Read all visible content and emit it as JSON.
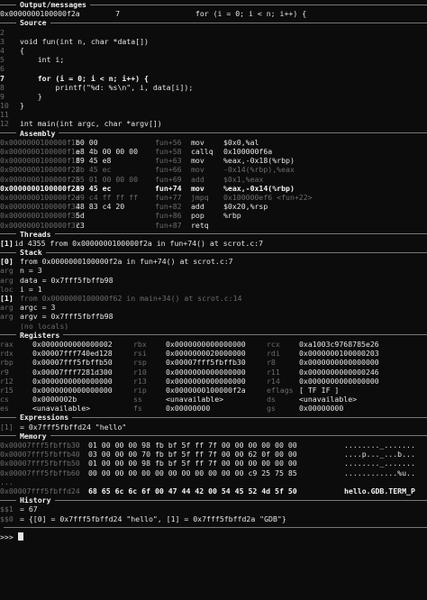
{
  "output": {
    "title": "Output/messages",
    "line": "0x0000000100000f2a        7                 for (i = 0; i < n; i++) {"
  },
  "source": {
    "title": "Source",
    "lines": [
      {
        "num": "2",
        "text": "",
        "cur": false
      },
      {
        "num": "3",
        "text": "void fun(int n, char *data[])",
        "cur": false
      },
      {
        "num": "4",
        "text": "{",
        "cur": false
      },
      {
        "num": "5",
        "text": "    int i;",
        "cur": false
      },
      {
        "num": "6",
        "text": "",
        "cur": false
      },
      {
        "num": "7",
        "text": "    for (i = 0; i < n; i++) {",
        "cur": true
      },
      {
        "num": "8",
        "text": "        printf(\"%d: %s\\n\", i, data[i]);",
        "cur": false
      },
      {
        "num": "9",
        "text": "    }",
        "cur": false
      },
      {
        "num": "10",
        "text": "}",
        "cur": false
      },
      {
        "num": "11",
        "text": "",
        "cur": false
      },
      {
        "num": "12",
        "text": "int main(int argc, char *argv[])",
        "cur": false
      }
    ]
  },
  "assembly": {
    "title": "Assembly",
    "lines": [
      {
        "addr": "0x0000000100000f18",
        "bytes": "b0 00",
        "sym": "fun+56",
        "mnem": "mov",
        "ops": "$0x0,%al",
        "dim": false
      },
      {
        "addr": "0x0000000100000f1a",
        "bytes": "e8 4b 00 00 00",
        "sym": "fun+58",
        "mnem": "callq",
        "ops": "0x100000f6a",
        "dim": false
      },
      {
        "addr": "0x0000000100000f1f",
        "bytes": "89 45 e8",
        "sym": "fun+63",
        "mnem": "mov",
        "ops": "%eax,-0x18(%rbp)",
        "dim": false
      },
      {
        "addr": "0x0000000100000f22",
        "bytes": "8b 45 ec",
        "sym": "fun+66",
        "mnem": "mov",
        "ops": "-0x14(%rbp),%eax",
        "dim": true
      },
      {
        "addr": "0x0000000100000f25",
        "bytes": "05 01 00 00 00",
        "sym": "fun+69",
        "mnem": "add",
        "ops": "$0x1,%eax",
        "dim": true
      },
      {
        "addr": "0x0000000100000f2a",
        "bytes": "89 45 ec",
        "sym": "fun+74",
        "mnem": "mov",
        "ops": "%eax,-0x14(%rbp)",
        "dim": false,
        "cur": true
      },
      {
        "addr": "0x0000000100000f2d",
        "bytes": "e9 c4 ff ff ff",
        "sym": "fun+77",
        "mnem": "jmpq",
        "ops": "0x100000ef6 <fun+22>",
        "dim": true
      },
      {
        "addr": "0x0000000100000f32",
        "bytes": "48 83 c4 20",
        "sym": "fun+82",
        "mnem": "add",
        "ops": "$0x20,%rsp",
        "dim": false
      },
      {
        "addr": "0x0000000100000f36",
        "bytes": "5d",
        "sym": "fun+86",
        "mnem": "pop",
        "ops": "%rbp",
        "dim": false
      },
      {
        "addr": "0x0000000100000f37",
        "bytes": "c3",
        "sym": "fun+87",
        "mnem": "retq",
        "ops": "",
        "dim": false
      }
    ]
  },
  "threads": {
    "title": "Threads",
    "lines": [
      {
        "idx": "[1]",
        "text": "id 4355 from 0x0000000100000f2a in fun+74() at scrot.c:7"
      }
    ]
  },
  "stack": {
    "title": "Stack",
    "lines": [
      {
        "pre": "[0]",
        "text": "from 0x0000000100000f2a in fun+74() at scrot.c:7",
        "dim": false
      },
      {
        "pre": "arg",
        "text": "n = 3",
        "dim": false
      },
      {
        "pre": "arg",
        "text": "data = 0x7fff5fbffb98",
        "dim": false
      },
      {
        "pre": "loc",
        "text": "i = 1",
        "dim": false
      },
      {
        "pre": "[1]",
        "text": "from 0x0000000100000f62 in main+34() at scrot.c:14",
        "dim": true
      },
      {
        "pre": "arg",
        "text": "argc = 3",
        "dim": false
      },
      {
        "pre": "arg",
        "text": "argv = 0x7fff5fbffb98",
        "dim": false
      },
      {
        "pre": "",
        "text": "(no locals)",
        "dim": true
      }
    ]
  },
  "registers": {
    "title": "Registers",
    "rows": [
      [
        [
          "rax",
          "0x0000000000000002"
        ],
        [
          "rbx",
          "0x0000000000000000"
        ],
        [
          "rcx",
          "0xa1003c9768785e26"
        ]
      ],
      [
        [
          "rdx",
          "0x00007fff740ed128"
        ],
        [
          "rsi",
          "0x0000000020000000"
        ],
        [
          "rdi",
          "0x0000000100000203"
        ]
      ],
      [
        [
          "rbp",
          "0x00007fff5fbffb50"
        ],
        [
          "rsp",
          "0x00007fff5fbffb30"
        ],
        [
          "r8",
          "0x0000000000000000"
        ]
      ],
      [
        [
          "r9",
          "0x00007fff7281d300"
        ],
        [
          "r10",
          "0x0000000000000000"
        ],
        [
          "r11",
          "0x0000000000000246"
        ]
      ],
      [
        [
          "r12",
          "0x0000000000000000"
        ],
        [
          "r13",
          "0x0000000000000000"
        ],
        [
          "r14",
          "0x0000000000000000"
        ]
      ],
      [
        [
          "r15",
          "0x0000000000000000"
        ],
        [
          "rip",
          "0x0000000100000f2a"
        ],
        [
          "eflags",
          "[ TF IF ]"
        ]
      ],
      [
        [
          "cs",
          "0x0000002b"
        ],
        [
          "ss",
          "<unavailable>"
        ],
        [
          "ds",
          "<unavailable>"
        ]
      ],
      [
        [
          "es",
          "<unavailable>"
        ],
        [
          "fs",
          "0x00000000"
        ],
        [
          "gs",
          "0x00000000"
        ]
      ]
    ]
  },
  "expressions": {
    "title": "Expressions",
    "lines": [
      {
        "pre": "[1]",
        "text": "= 0x7fff5fbffd24 \"hello\""
      }
    ]
  },
  "memory": {
    "title": "Memory",
    "lines": [
      {
        "addr": "0x00007fff5fbffb30",
        "hex": "01 00 00 00 98 fb bf 5f ff 7f 00 00 00 00 00 00",
        "ascii": "........_......."
      },
      {
        "addr": "0x00007fff5fbffb40",
        "hex": "03 00 00 00 70 fb bf 5f ff 7f 00 00 62 0f 00 00",
        "ascii": "....p..._...b..."
      },
      {
        "addr": "0x00007fff5fbffb50",
        "hex": "01 00 00 00 98 fb bf 5f ff 7f 00 00 00 00 00 00",
        "ascii": "........_......."
      },
      {
        "addr": "0x00007fff5fbffb60",
        "hex": "00 00 00 00 00 00 00 00 00 00 00 00 c9 25 75 85",
        "ascii": "............%u.."
      },
      {
        "addr": "...",
        "hex": "",
        "ascii": ""
      },
      {
        "addr": "0x00007fff5fbffd24",
        "hex": "68 65 6c 6c 6f 00 47 44 42 00 54 45 52 4d 5f 50",
        "ascii": "hello.GDB.TERM_P"
      }
    ]
  },
  "history": {
    "title": "History",
    "lines": [
      {
        "pre": "$$1",
        "text": "= 67"
      },
      {
        "pre": "$$0",
        "text": "= {[0] = 0x7fff5fbffd24 \"hello\", [1] = 0x7fff5fbffd2a \"GDB\"}"
      }
    ]
  },
  "prompt": ">>>"
}
